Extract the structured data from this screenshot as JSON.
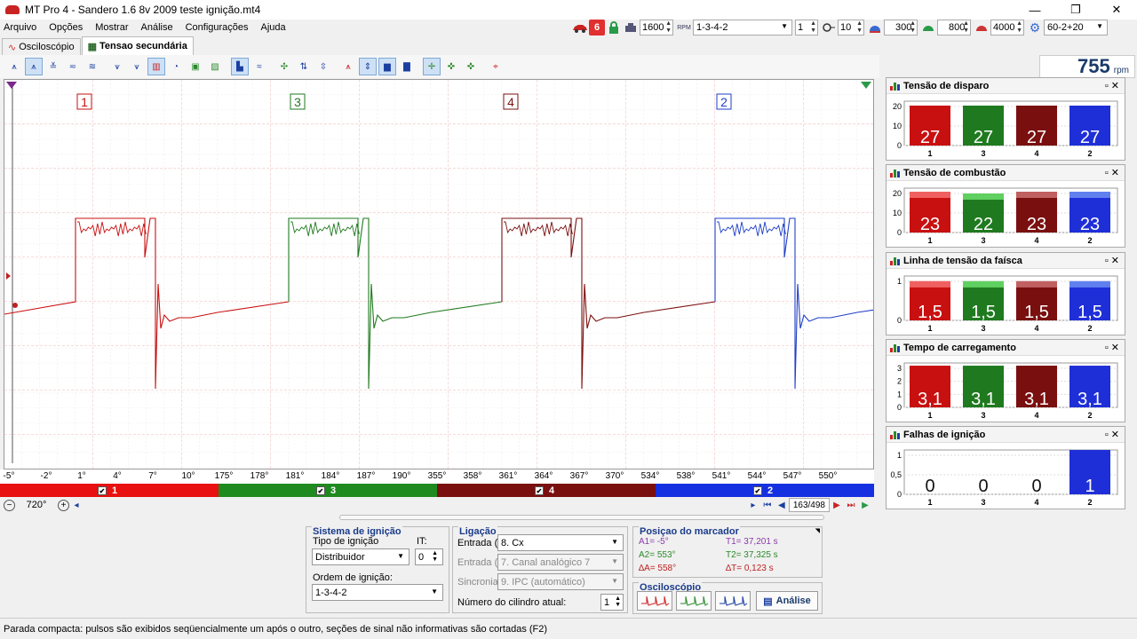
{
  "window": {
    "title": "MT Pro 4 - Sandero 1.6 8v 2009 teste ignição.mt4",
    "minimize": "—",
    "maximize": "❐",
    "close": "✕"
  },
  "menu": [
    {
      "label": "Arquivo"
    },
    {
      "label": "Opções"
    },
    {
      "label": "Mostrar"
    },
    {
      "label": "Análise"
    },
    {
      "label": "Configurações"
    },
    {
      "label": "Ajuda"
    }
  ],
  "topbar": {
    "spin1": "1600",
    "firing_order": "1-3-4-2",
    "spin2": "1",
    "spin3": "10",
    "spin4": "300",
    "spin5": "800",
    "spin6": "4000",
    "trigger": "60-2+20",
    "badge": "6",
    "rpm_small": "RPM"
  },
  "tabs": [
    {
      "label": "Osciloscópio",
      "active": false
    },
    {
      "label": "Tensao secundária",
      "active": true
    }
  ],
  "rpm": {
    "value": "755",
    "unit": "rpm"
  },
  "scope": {
    "cylinder_labels": [
      {
        "num": "1",
        "color": "#c81010"
      },
      {
        "num": "3",
        "color": "#1f7a1f"
      },
      {
        "num": "4",
        "color": "#7a1010"
      },
      {
        "num": "2",
        "color": "#1f3fc8"
      }
    ],
    "angle_ticks": [
      "-5°",
      "-2°",
      "1°",
      "4°",
      "7°",
      "10°",
      "175°",
      "178°",
      "181°",
      "184°",
      "187°",
      "190°",
      "355°",
      "358°",
      "361°",
      "364°",
      "367°",
      "370°",
      "534°",
      "538°",
      "541°",
      "544°",
      "547°",
      "550°"
    ],
    "zoom": "720°",
    "page": "163/498"
  },
  "cylinder_bar": [
    {
      "label": "1",
      "color": "#e81010",
      "checked": "✔"
    },
    {
      "label": "3",
      "color": "#1f8a1f",
      "checked": "✔"
    },
    {
      "label": "4",
      "color": "#7a0f0f",
      "checked": "✔"
    },
    {
      "label": "2",
      "color": "#1530e0",
      "checked": "✔"
    }
  ],
  "panels": [
    {
      "title": "Tensão de disparo",
      "yticks": [
        "20",
        "10",
        "0"
      ],
      "ymax": 30,
      "cats": [
        "1",
        "3",
        "4",
        "2"
      ],
      "values": [
        27,
        27,
        27,
        27
      ],
      "labels": [
        "27",
        "27",
        "27",
        "27"
      ]
    },
    {
      "title": "Tensão de combustão",
      "yticks": [
        "20",
        "10",
        "0"
      ],
      "ymax": 25,
      "cats": [
        "1",
        "3",
        "4",
        "2"
      ],
      "values": [
        23,
        22,
        23,
        23
      ],
      "labels": [
        "23",
        "22",
        "23",
        "23"
      ]
    },
    {
      "title": "Linha de tensão da faísca",
      "yticks": [
        "1",
        "0"
      ],
      "ymax": 1.7,
      "cats": [
        "1",
        "3",
        "4",
        "2"
      ],
      "values": [
        1.5,
        1.5,
        1.5,
        1.5
      ],
      "labels": [
        "1,5",
        "1,5",
        "1,5",
        "1,5"
      ]
    },
    {
      "title": "Tempo de carregamento",
      "yticks": [
        "3",
        "2",
        "1",
        "0"
      ],
      "ymax": 3.3,
      "cats": [
        "1",
        "3",
        "4",
        "2"
      ],
      "values": [
        3.1,
        3.1,
        3.1,
        3.1
      ],
      "labels": [
        "3,1",
        "3,1",
        "3,1",
        "3,1"
      ]
    },
    {
      "title": "Falhas de ignição",
      "yticks": [
        "1",
        "0,5",
        "0"
      ],
      "ymax": 1,
      "cats": [
        "1",
        "3",
        "4",
        "2"
      ],
      "values": [
        0,
        0,
        0,
        1
      ],
      "labels": [
        "0",
        "0",
        "0",
        "1"
      ]
    }
  ],
  "chart_data": [
    {
      "type": "bar",
      "title": "Tensão de disparo",
      "categories": [
        "1",
        "3",
        "4",
        "2"
      ],
      "values": [
        27,
        27,
        27,
        27
      ],
      "ylim": [
        0,
        30
      ]
    },
    {
      "type": "bar",
      "title": "Tensão de combustão",
      "categories": [
        "1",
        "3",
        "4",
        "2"
      ],
      "values": [
        23,
        22,
        23,
        23
      ],
      "ylim": [
        0,
        25
      ]
    },
    {
      "type": "bar",
      "title": "Linha de tensão da faísca",
      "categories": [
        "1",
        "3",
        "4",
        "2"
      ],
      "values": [
        1.5,
        1.5,
        1.5,
        1.5
      ],
      "ylim": [
        0,
        1.7
      ]
    },
    {
      "type": "bar",
      "title": "Tempo de carregamento",
      "categories": [
        "1",
        "3",
        "4",
        "2"
      ],
      "values": [
        3.1,
        3.1,
        3.1,
        3.1
      ],
      "ylim": [
        0,
        3.3
      ]
    },
    {
      "type": "bar",
      "title": "Falhas de ignição",
      "categories": [
        "1",
        "3",
        "4",
        "2"
      ],
      "values": [
        0,
        0,
        0,
        1
      ],
      "ylim": [
        0,
        1
      ]
    }
  ],
  "ignition_system": {
    "title": "Sistema de ignição",
    "type_label": "Tipo de ignição",
    "type_value": "Distribuidor",
    "it_label": "IT:",
    "it_value": "0",
    "order_label": "Ordem de ignição:",
    "order_value": "1-3-4-2"
  },
  "connection": {
    "title": "Ligação",
    "entrada_label": "Entrada (",
    "entrada_value": "8. Cx",
    "entrada2_label": "Entrada (",
    "entrada2_value": "7. Canal analógico 7",
    "sync_label": "Sincronia:",
    "sync_value": "9. IPC (automático)",
    "cyl_label": "Número do cilindro atual:",
    "cyl_value": "1"
  },
  "marker": {
    "title": "Posiçao do marcador",
    "a1": "A1= -5°",
    "t1": "T1= 37,201 s",
    "a2": "A2= 553°",
    "t2": "T2= 37,325 s",
    "da": "∆A= 558°",
    "dt": "∆T= 0,123 s"
  },
  "oscilloscope": {
    "title": "Osciloscópio",
    "analysis_button": "Análise"
  },
  "status": "Parada compacta: pulsos são exibidos seqüencialmente um após o outro, seções de sinal não informativas são cortadas (F2)"
}
